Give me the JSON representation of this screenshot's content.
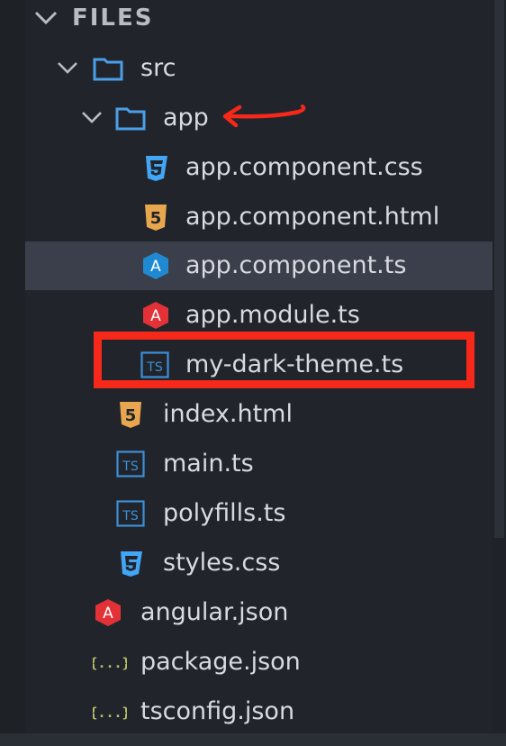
{
  "panel": {
    "title": "FILES"
  },
  "tree": {
    "src": {
      "label": "src",
      "icon": "folder-icon"
    },
    "app": {
      "label": "app",
      "icon": "folder-icon"
    },
    "app_component_css": {
      "label": "app.component.css",
      "icon": "css-file-icon"
    },
    "app_component_html": {
      "label": "app.component.html",
      "icon": "html5-file-icon"
    },
    "app_component_ts": {
      "label": "app.component.ts",
      "icon": "angular-component-icon"
    },
    "app_module_ts": {
      "label": "app.module.ts",
      "icon": "angular-icon"
    },
    "my_dark_theme_ts": {
      "label": "my-dark-theme.ts",
      "icon": "typescript-file-icon"
    },
    "index_html": {
      "label": "index.html",
      "icon": "html5-file-icon"
    },
    "main_ts": {
      "label": "main.ts",
      "icon": "typescript-file-icon"
    },
    "polyfills_ts": {
      "label": "polyfills.ts",
      "icon": "typescript-file-icon"
    },
    "styles_css": {
      "label": "styles.css",
      "icon": "css-file-icon"
    },
    "angular_json": {
      "label": "angular.json",
      "icon": "angular-icon"
    },
    "package_json": {
      "label": "package.json",
      "icon": "json-file-icon"
    },
    "tsconfig_json": {
      "label": "tsconfig.json",
      "icon": "json-file-icon"
    }
  },
  "selected_item": "app.component.ts",
  "colors": {
    "background": "#21252b",
    "selection": "#3a3f4b",
    "text": "#d7dae0",
    "folder_blue": "#4a9fe8",
    "ts_blue": "#3d8fd6",
    "css_blue": "#42a5f5",
    "html_orange": "#e8a64f",
    "angular_red": "#e23237",
    "json_green": "#b5bd68",
    "annotation_red": "#f5281a"
  },
  "icon_text": {
    "ts": "TS",
    "html5": "5",
    "angular": "A",
    "json": "{...}"
  }
}
